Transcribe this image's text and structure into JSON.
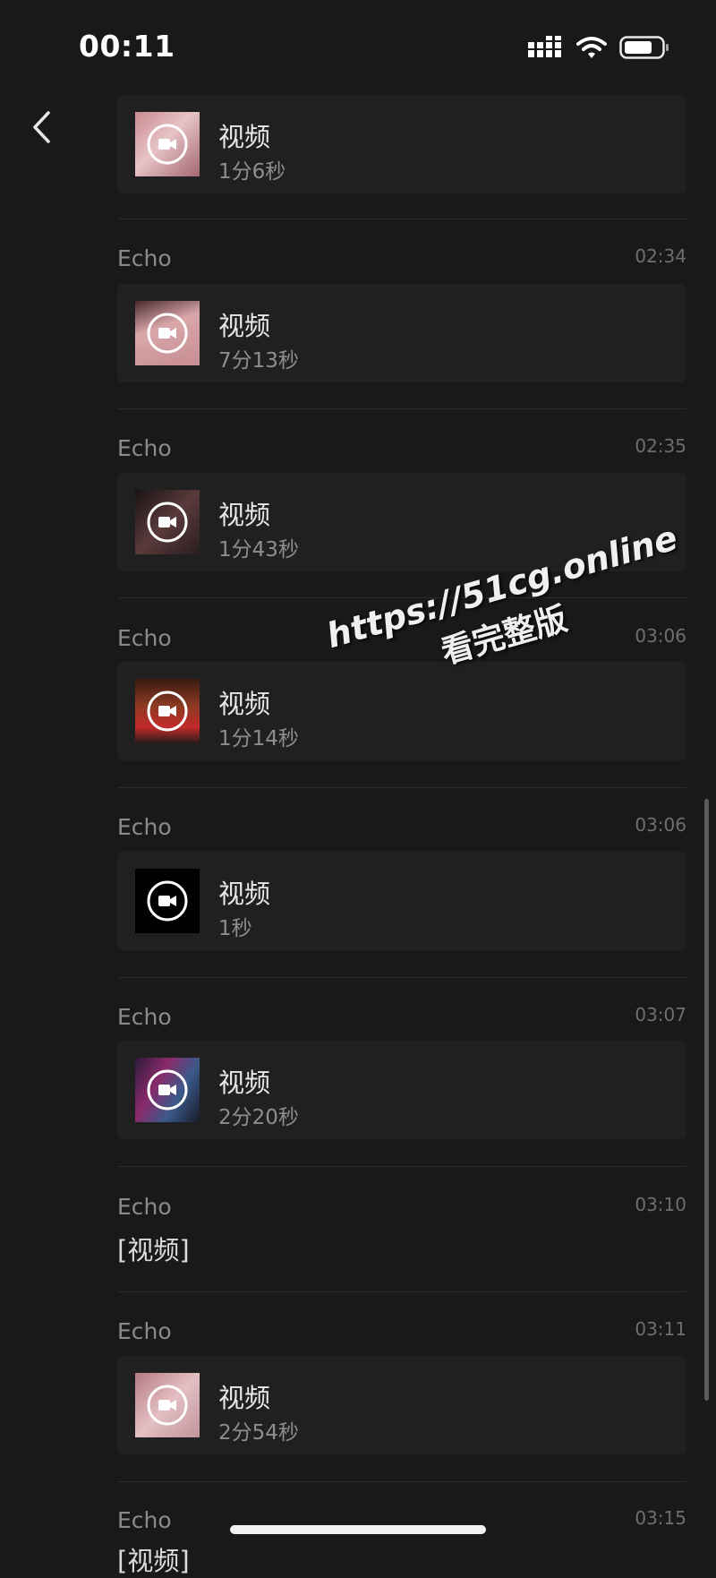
{
  "status_bar": {
    "time": "00:11"
  },
  "header": {
    "back_icon": "chevron-left-icon",
    "more_icon": "ellipsis-icon"
  },
  "entries": [
    {
      "sender": "",
      "time": "",
      "type": "video",
      "title": "视频",
      "duration": "1分6秒",
      "thumb": "pink"
    },
    {
      "sender": "Echo",
      "time": "02:34",
      "type": "video",
      "title": "视频",
      "duration": "7分13秒",
      "thumb": "pink"
    },
    {
      "sender": "Echo",
      "time": "02:35",
      "type": "video",
      "title": "视频",
      "duration": "1分43秒",
      "thumb": "dark"
    },
    {
      "sender": "Echo",
      "time": "03:06",
      "type": "video",
      "title": "视频",
      "duration": "1分14秒",
      "thumb": "party"
    },
    {
      "sender": "Echo",
      "time": "03:06",
      "type": "video",
      "title": "视频",
      "duration": "1秒",
      "thumb": "black"
    },
    {
      "sender": "Echo",
      "time": "03:07",
      "type": "video",
      "title": "视频",
      "duration": "2分20秒",
      "thumb": "club"
    },
    {
      "sender": "Echo",
      "time": "03:10",
      "type": "text",
      "text": "[视频]"
    },
    {
      "sender": "Echo",
      "time": "03:11",
      "type": "video",
      "title": "视频",
      "duration": "2分54秒",
      "thumb": "pink"
    },
    {
      "sender": "Echo",
      "time": "03:15",
      "type": "text",
      "text": "[视频]"
    }
  ],
  "watermark": {
    "url": "https://51cg.online",
    "text": "看完整版"
  },
  "colors": {
    "background": "#191919",
    "card": "#202020",
    "divider": "#2b2b2b"
  }
}
